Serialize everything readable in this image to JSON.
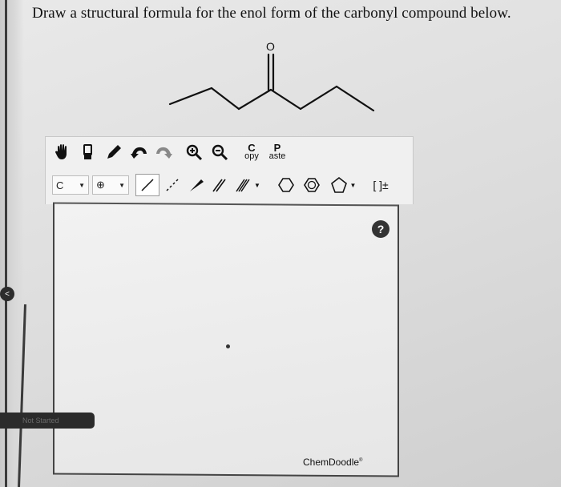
{
  "question": {
    "prompt": "Draw a structural formula for the enol form of the carbonyl compound below."
  },
  "molecule": {
    "atom_label_oxygen": "O"
  },
  "toolbar": {
    "copy": {
      "big": "C",
      "small": "opy"
    },
    "paste": {
      "big": "P",
      "small": "aste"
    },
    "element_selector": "C",
    "charge_selector": "⊕",
    "bracket_tool": "[ ]±",
    "icons": [
      "hand-icon",
      "eraser-icon",
      "pencil-icon",
      "undo-icon",
      "redo-icon",
      "zoom-in-icon",
      "zoom-out-icon"
    ]
  },
  "canvas": {
    "help_label": "?",
    "brand": "ChemDoodle",
    "brand_mark": "®"
  },
  "side": {
    "button_label": "Not Started",
    "back_label": "<"
  },
  "colors": {
    "toolbar_bg": "#f0f0f0",
    "canvas_border": "#444444"
  }
}
